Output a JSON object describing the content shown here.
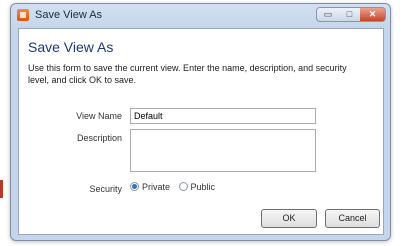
{
  "window": {
    "title": "Save View As",
    "minimize_glyph": "▭",
    "maximize_glyph": "□",
    "close_glyph": "✕"
  },
  "form": {
    "heading": "Save View As",
    "description": "Use this form to save the current view. Enter the name, description, and security level, and click OK to save.",
    "view_name_label": "View Name",
    "view_name_value": "Default",
    "description_label": "Description",
    "description_value": "",
    "security_label": "Security",
    "security_options": [
      "Private",
      "Public"
    ],
    "security_selected": "Private"
  },
  "buttons": {
    "ok_label": "OK",
    "cancel_label": "Cancel"
  },
  "colors": {
    "accent": "#2a6fd6",
    "heading": "#1a3a7a",
    "close_button": "#c8432a"
  },
  "icons": {
    "app": "app-icon",
    "minimize": "minimize-icon",
    "maximize": "maximize-icon",
    "close": "close-icon"
  }
}
